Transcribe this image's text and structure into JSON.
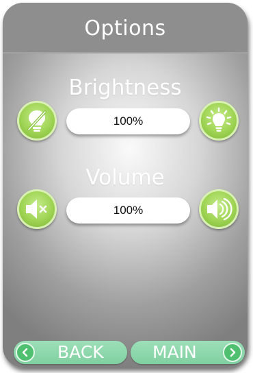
{
  "header": {
    "title": "Options"
  },
  "brightness": {
    "label": "Brightness",
    "value": "100%",
    "decrease_icon": "bulb-off-icon",
    "increase_icon": "bulb-on-icon"
  },
  "volume": {
    "label": "Volume",
    "value": "100%",
    "decrease_icon": "speaker-mute-icon",
    "increase_icon": "speaker-loud-icon"
  },
  "nav": {
    "back_label": "BACK",
    "main_label": "MAIN"
  },
  "colors": {
    "accent_green": "#9fd454",
    "nav_green": "#8fd8ad",
    "chevron_green": "#4fbf70",
    "titlebar": "#8e8e8e"
  }
}
